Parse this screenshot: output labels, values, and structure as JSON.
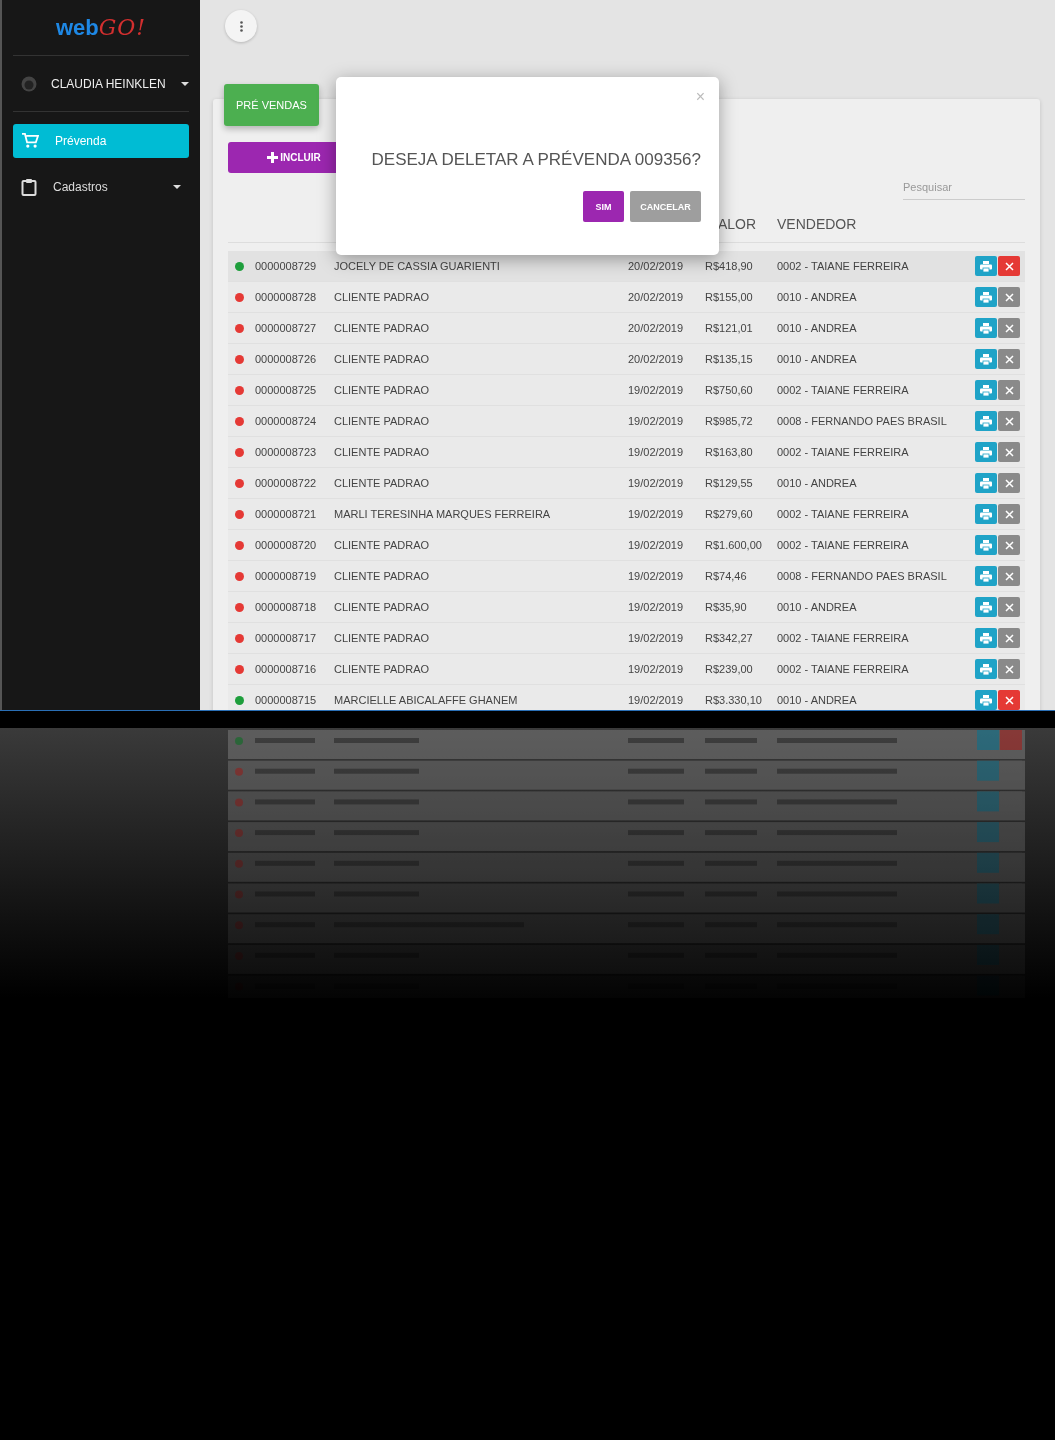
{
  "sidebar": {
    "logo": {
      "part_1": "web",
      "part_2": "GO!"
    },
    "user": {
      "name": "CLAUDIA HEINKLEN"
    },
    "items": [
      {
        "label": "Prévenda",
        "selected": true,
        "kind": "cart"
      },
      {
        "label": "Cadastros",
        "selected": false,
        "kind": "group"
      }
    ]
  },
  "panel": {
    "tab": "PRÉ VENDAS",
    "add_button": "INCLUIR",
    "search": {
      "placeholder": "Pesquisar"
    },
    "columns": [
      "ALOR",
      "VENDEDOR"
    ],
    "rows": [
      {
        "code": "0000008729",
        "client": "JOCELY DE CASSIA GUARIENTI",
        "date": "20/02/2019",
        "value": "R$418,90",
        "seller": "0002 - TAIANE FERREIRA",
        "color": "#1e9e3c",
        "delete_enabled": true
      },
      {
        "code": "0000008728",
        "client": "CLIENTE PADRAO",
        "date": "20/02/2019",
        "value": "R$155,00",
        "seller": "0010 - ANDREA",
        "color": "#e53935",
        "delete_enabled": false
      },
      {
        "code": "0000008727",
        "client": "CLIENTE PADRAO",
        "date": "20/02/2019",
        "value": "R$121,01",
        "seller": "0010 - ANDREA",
        "color": "#e53935",
        "delete_enabled": false
      },
      {
        "code": "0000008726",
        "client": "CLIENTE PADRAO",
        "date": "20/02/2019",
        "value": "R$135,15",
        "seller": "0010 - ANDREA",
        "color": "#e53935",
        "delete_enabled": false
      },
      {
        "code": "0000008725",
        "client": "CLIENTE PADRAO",
        "date": "19/02/2019",
        "value": "R$750,60",
        "seller": "0002 - TAIANE FERREIRA",
        "color": "#e53935",
        "delete_enabled": false
      },
      {
        "code": "0000008724",
        "client": "CLIENTE PADRAO",
        "date": "19/02/2019",
        "value": "R$985,72",
        "seller": "0008 - FERNANDO PAES BRASIL",
        "color": "#e53935",
        "delete_enabled": false
      },
      {
        "code": "0000008723",
        "client": "CLIENTE PADRAO",
        "date": "19/02/2019",
        "value": "R$163,80",
        "seller": "0002 - TAIANE FERREIRA",
        "color": "#e53935",
        "delete_enabled": false
      },
      {
        "code": "0000008722",
        "client": "CLIENTE PADRAO",
        "date": "19/02/2019",
        "value": "R$129,55",
        "seller": "0010 - ANDREA",
        "color": "#e53935",
        "delete_enabled": false
      },
      {
        "code": "0000008721",
        "client": "MARLI TERESINHA MARQUES FERREIRA",
        "date": "19/02/2019",
        "value": "R$279,60",
        "seller": "0002 - TAIANE FERREIRA",
        "color": "#e53935",
        "delete_enabled": false
      },
      {
        "code": "0000008720",
        "client": "CLIENTE PADRAO",
        "date": "19/02/2019",
        "value": "R$1.600,00",
        "seller": "0002 - TAIANE FERREIRA",
        "color": "#e53935",
        "delete_enabled": false
      },
      {
        "code": "0000008719",
        "client": "CLIENTE PADRAO",
        "date": "19/02/2019",
        "value": "R$74,46",
        "seller": "0008 - FERNANDO PAES BRASIL",
        "color": "#e53935",
        "delete_enabled": false
      },
      {
        "code": "0000008718",
        "client": "CLIENTE PADRAO",
        "date": "19/02/2019",
        "value": "R$35,90",
        "seller": "0010 - ANDREA",
        "color": "#e53935",
        "delete_enabled": false
      },
      {
        "code": "0000008717",
        "client": "CLIENTE PADRAO",
        "date": "19/02/2019",
        "value": "R$342,27",
        "seller": "0002 - TAIANE FERREIRA",
        "color": "#e53935",
        "delete_enabled": false
      },
      {
        "code": "0000008716",
        "client": "CLIENTE PADRAO",
        "date": "19/02/2019",
        "value": "R$239,00",
        "seller": "0002 - TAIANE FERREIRA",
        "color": "#e53935",
        "delete_enabled": false
      },
      {
        "code": "0000008715",
        "client": "MARCIELLE ABICALAFFE GHANEM",
        "date": "19/02/2019",
        "value": "R$3.330,10",
        "seller": "0010 - ANDREA",
        "color": "#1e9e3c",
        "delete_enabled": true
      }
    ]
  },
  "dialog": {
    "message": "DESEJA DELETAR A PRÉVENDA 009356?",
    "confirm": "SIM",
    "cancel": "CANCELAR",
    "close": "×"
  }
}
